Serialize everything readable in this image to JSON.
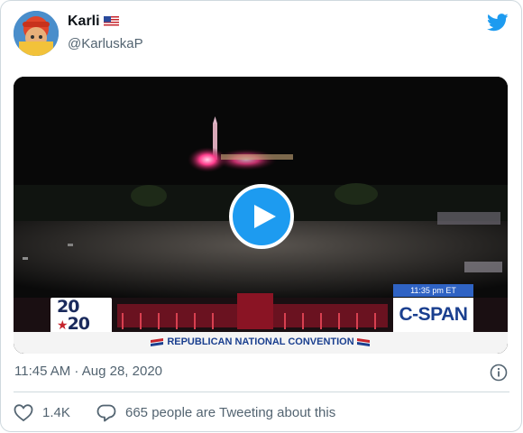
{
  "author": {
    "display_name": "Karli",
    "handle": "@KarluskaP",
    "flag_icon": "us-flag-icon"
  },
  "brand": {
    "icon": "twitter-bird-icon",
    "color": "#1d9bf0"
  },
  "video": {
    "play_icon": "play-icon",
    "overlay": {
      "logo_line1": "20",
      "logo_line2": "20",
      "broadcast_time": "11:35 pm ET",
      "network": "C-SPAN",
      "banner": "REPUBLICAN NATIONAL CONVENTION"
    }
  },
  "timestamp": "11:45 AM · Aug 28, 2020",
  "info_icon": "info-icon",
  "actions": {
    "like_count": "1.4K",
    "reply_text": "665 people are Tweeting about this"
  },
  "colors": {
    "text_secondary": "#536471",
    "border": "#cfd9de",
    "cspan_blue": "#1a3f8f"
  }
}
